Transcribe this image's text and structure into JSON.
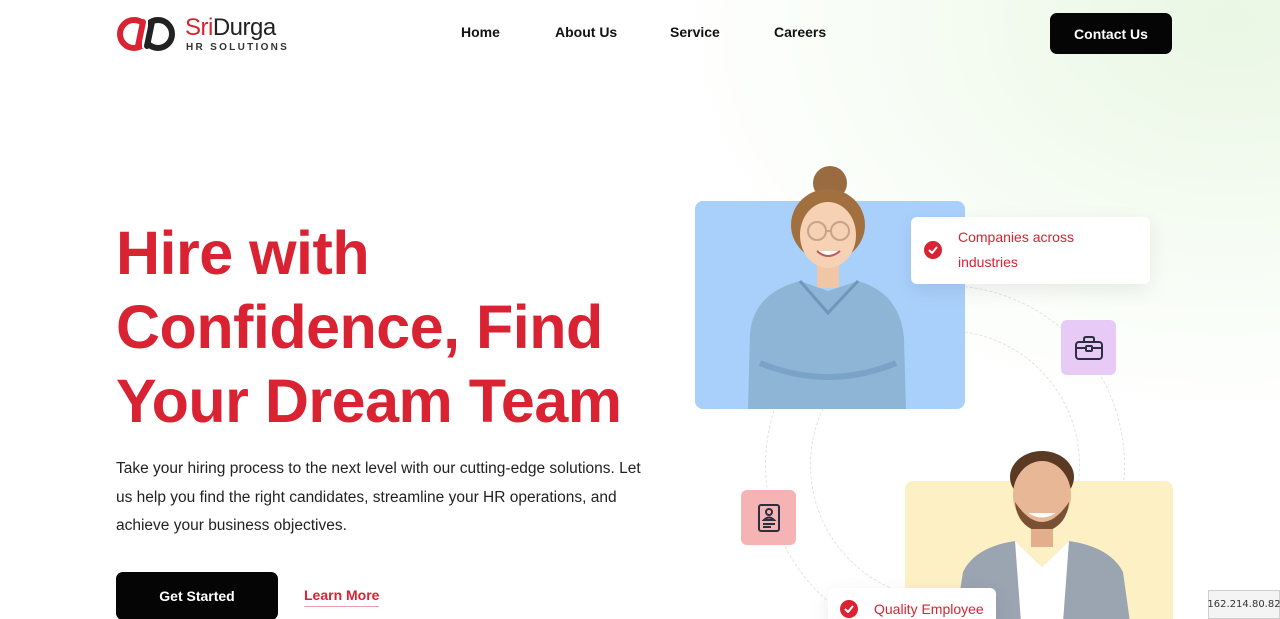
{
  "brand": {
    "name_part1": "Sri",
    "name_part2": "Durga",
    "subtitle": "HR SOLUTIONS",
    "accent_color": "#d92232"
  },
  "nav": {
    "items": [
      {
        "label": "Home"
      },
      {
        "label": "About Us"
      },
      {
        "label": "Service"
      },
      {
        "label": "Careers"
      }
    ],
    "contact_label": "Contact Us"
  },
  "hero": {
    "title": "Hire with Confidence, Find Your Dream Team",
    "description": "Take your hiring process to the next level with our cutting-edge solutions. Let us help you find the right candidates, streamline your HR operations, and achieve your business objectives.",
    "primary_cta": "Get Started",
    "secondary_cta": "Learn More"
  },
  "visual": {
    "badge_top": "Companies across industries",
    "badge_bottom": "Quality Employee",
    "icon_tile_1": "briefcase-icon",
    "icon_tile_2": "resume-icon",
    "card_colors": [
      "#a9d0fb",
      "#fdf0c4"
    ]
  },
  "footer_overlay": {
    "ip_text": "162.214.80.82"
  }
}
